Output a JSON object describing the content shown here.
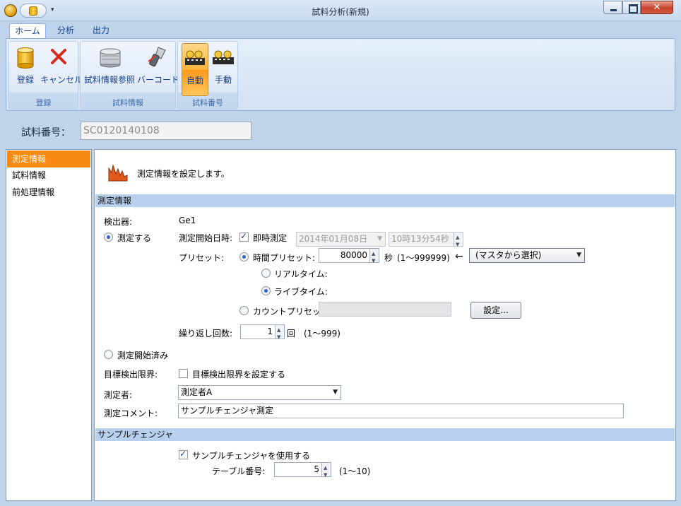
{
  "window": {
    "title": "試料分析(新規)",
    "close_glyph": "✕",
    "qat_arrow": "▾"
  },
  "ribbon": {
    "tabs": [
      {
        "label": "ホーム"
      },
      {
        "label": "分析"
      },
      {
        "label": "出力"
      }
    ],
    "groups": [
      {
        "label": "登録",
        "buttons": [
          {
            "label": "登録",
            "icon": "register-cylinder-icon"
          },
          {
            "label": "キャンセル",
            "icon": "cancel-x-icon"
          }
        ]
      },
      {
        "label": "試料情報",
        "buttons": [
          {
            "label": "試料情報参照",
            "icon": "sample-container-icon"
          },
          {
            "label": "バーコード",
            "icon": "barcode-scanner-icon"
          }
        ]
      },
      {
        "label": "試料番号",
        "buttons": [
          {
            "label": "自動",
            "icon": "auto-number-icon"
          },
          {
            "label": "手動",
            "icon": "manual-number-icon"
          }
        ]
      }
    ]
  },
  "sample": {
    "label": "試料番号：",
    "value": "SC0120140108"
  },
  "nav": {
    "items": [
      {
        "label": "測定情報"
      },
      {
        "label": "試料情報"
      },
      {
        "label": "前処理情報"
      }
    ]
  },
  "content": {
    "intro": "測定情報を設定します。",
    "measurement": {
      "section_title": "測定情報",
      "detector_label": "検出器:",
      "detector_value": "Ge1",
      "measure_radio": "測定する",
      "start_datetime_label": "測定開始日時:",
      "immediate_check": "即時測定",
      "date_value": "2014年01月08日",
      "time_value": "10時13分54秒",
      "preset_label": "プリセット:",
      "time_preset_radio": "時間プリセット:",
      "time_preset_value": "80000",
      "time_unit": "秒",
      "time_range": "(1〜999999)",
      "arrow": "←",
      "master_select": "(マスタから選択)",
      "realtime_radio": "リアルタイム:",
      "livetime_radio": "ライブタイム:",
      "count_preset_radio": "カウントプリセット:",
      "count_preset_value": "",
      "settings_button": "設定...",
      "repeat_label": "繰り返し回数:",
      "repeat_value": "1",
      "repeat_unit": "回",
      "repeat_range": "(1〜999)",
      "started_radio": "測定開始済み",
      "target_limit_label": "目標検出限界:",
      "target_limit_check": "目標検出限界を設定する",
      "operator_label": "測定者:",
      "operator_value": "測定者A",
      "comment_label": "測定コメント:",
      "comment_value": "サンプルチェンジャ測定"
    },
    "changer": {
      "section_title": "サンプルチェンジャ",
      "use_check": "サンプルチェンジャを使用する",
      "table_label": "テーブル番号:",
      "table_value": "5",
      "table_range": "(1〜10)"
    }
  }
}
